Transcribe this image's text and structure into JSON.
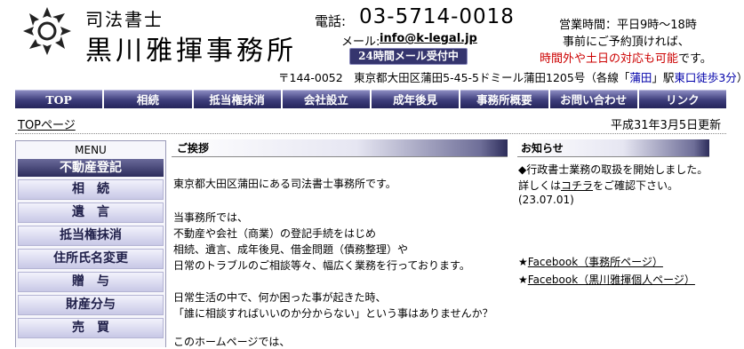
{
  "header": {
    "firm_small": "司法書士",
    "firm_name": "黒川雅揮事務所",
    "tel_label": "電話:",
    "tel_number": "03-5714-0018",
    "mail_label": "メール:",
    "mail_address": "info@k-legal.jp",
    "mail_badge": "24時間メール受付中",
    "hours_1": "営業時間：平日9時〜18時",
    "hours_2": "事前にご予約頂ければ、",
    "hours_3_red": "時間外や土日の対応も可能",
    "hours_3_tail": "です。",
    "address_pre": "〒144-0052　東京都大田区蒲田5-45-5ドミール蒲田1205号（各線「",
    "address_station": "蒲田",
    "address_mid": "」駅",
    "address_exit": "東口徒歩3分",
    "address_post": "）"
  },
  "nav": [
    "TOP",
    "相続",
    "抵当権抹消",
    "会社設立",
    "成年後見",
    "事務所概要",
    "お問い合わせ",
    "リンク"
  ],
  "breadcrumb": "TOPページ",
  "updated": "平成31年3月5日更新",
  "menu": {
    "title": "MENU",
    "head": "不動産登記",
    "items": [
      "相　続",
      "遺　言",
      "抵当権抹消",
      "住所氏名変更",
      "贈　与",
      "財産分与",
      "売　買"
    ]
  },
  "greeting": {
    "title": "ご挨拶",
    "lines": [
      "東京都大田区蒲田にある司法書士事務所です。",
      "当事務所では、",
      "不動産や会社（商業）の登記手続をはじめ",
      "相続、遺言、成年後見、借金問題（債務整理）や",
      "日常のトラブルのご相談等々、幅広く業務を行っております。",
      "日常生活の中で、何か困った事が起きた時、",
      "「誰に相談すればいいのか分からない」という事はありませんか？",
      "このホームページでは、"
    ]
  },
  "news": {
    "title": "お知らせ",
    "item1": "◆行政書士業務の取扱を開始しました。",
    "item1_detail_pre": "詳しくは",
    "item1_link": "コチラ",
    "item1_detail_post": "をご確認下さい。",
    "item1_date": "(23.07.01)",
    "fb1_star": "★",
    "fb1": "Facebook（事務所ページ）",
    "fb2_star": "★",
    "fb2": "Facebook（黒川雅揮個人ページ）"
  },
  "colors": {
    "nav_bg": "#3c3c7a",
    "red_text": "#cc0000",
    "blue_text": "#0000aa"
  }
}
